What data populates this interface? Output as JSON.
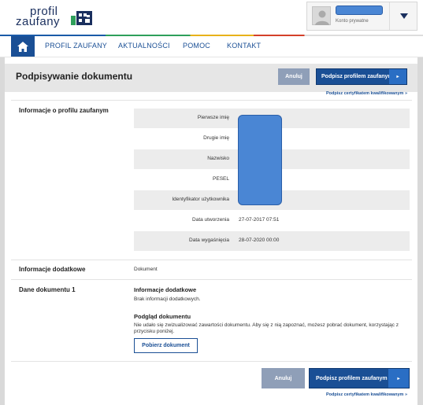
{
  "header": {
    "logo_line1": "profil",
    "logo_line2": "zaufany",
    "account_type": "Konto prywatne"
  },
  "nav": {
    "items": [
      "PROFIL ZAUFANY",
      "AKTUALNOŚCI",
      "POMOC",
      "KONTAKT"
    ]
  },
  "page": {
    "title": "Podpisywanie dokumentu",
    "cancel_label": "Anuluj",
    "sign_label": "Podpisz profilem zaufanym",
    "cert_link": "Podpisz certyfikatem kwalifikowanym »"
  },
  "profile": {
    "section_label": "Informacje o profilu zaufanym",
    "fields": [
      {
        "label": "Pierwsze imię",
        "value": ""
      },
      {
        "label": "Drugie imię",
        "value": ""
      },
      {
        "label": "Nazwisko",
        "value": ""
      },
      {
        "label": "PESEL",
        "value": ""
      },
      {
        "label": "Identyfikator użytkownika",
        "value": ""
      },
      {
        "label": "Data utworzenia",
        "value": "27-07-2017 07:51"
      },
      {
        "label": "Data wygaśnięcia",
        "value": "28-07-2020 00:00"
      }
    ]
  },
  "additional": {
    "section_label": "Informacje dodatkowe",
    "value": "Dokument"
  },
  "document": {
    "section_label": "Dane dokumentu 1",
    "info_heading": "Informacje dodatkowe",
    "info_text": "Brak informacji dodatkowych.",
    "preview_heading": "Podgląd dokumentu",
    "preview_text_line1": "Nie udało się zwizualizować zawartości dokumentu. Aby się z nią zapoznać, możesz pobrać dokument, korzystając z",
    "preview_text_line2": "przycisku poniżej.",
    "download_label": "Pobierz dokument"
  },
  "colors": {
    "brand": "#1a4f95",
    "cancel": "#8f9fb8",
    "redaction": "#4a86d4"
  }
}
